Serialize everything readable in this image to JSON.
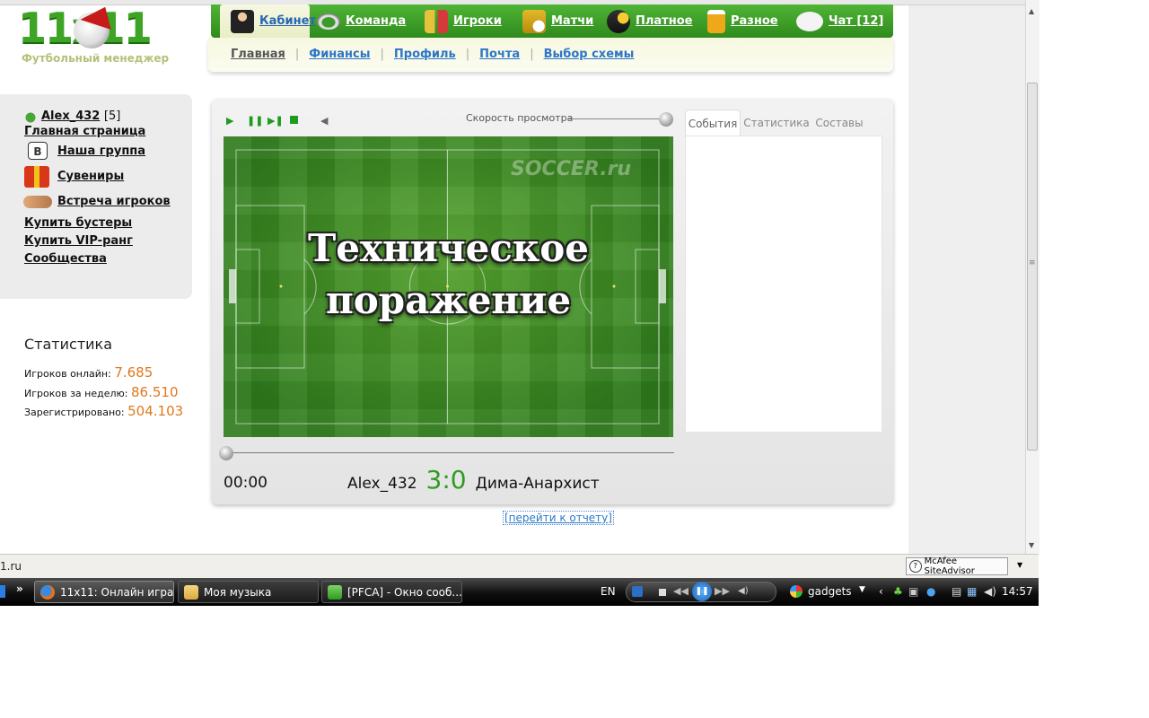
{
  "logo": {
    "number": "11x11",
    "subtitle": "Футбольный менеджер"
  },
  "topnav": [
    {
      "label": "Кабинет",
      "icon": "manager-icon"
    },
    {
      "label": "Команда",
      "icon": "stadium-icon"
    },
    {
      "label": "Игроки",
      "icon": "players-icon"
    },
    {
      "label": "Матчи",
      "icon": "trophy-ball-icon"
    },
    {
      "label": "Платное",
      "icon": "coins-icon"
    },
    {
      "label": "Разное",
      "icon": "beer-icon"
    },
    {
      "label": "Чат [12]",
      "icon": "chat-bubble-icon"
    }
  ],
  "subnav": [
    "Главная",
    "Финансы",
    "Профиль",
    "Почта",
    "Выбор схемы"
  ],
  "sidebar": {
    "user": "Alex_432",
    "user_level": "[5]",
    "main_page": "Главная страница",
    "group": "Наша группа",
    "souvenirs": "Сувениры",
    "meeting": "Встреча игроков",
    "buy_boosters": "Купить бустеры",
    "buy_vip": "Купить VIP-ранг",
    "communities": "Сообщества"
  },
  "stats": {
    "title": "Статистика",
    "online_label": "Игроков онлайн:",
    "online_value": "7.685",
    "week_label": "Игроков за неделю:",
    "week_value": "86.510",
    "registered_label": "Зарегистрировано:",
    "registered_value": "504.103"
  },
  "player": {
    "speed_label": "Скорость просмотра",
    "watermark": "SOCCER.ru",
    "overlay_line1": "Техническое",
    "overlay_line2": "поражение",
    "tabs": [
      "События",
      "Статистика",
      "Составы"
    ],
    "time": "00:00",
    "home": "Alex_432",
    "score": "3:0",
    "away": "Дима-Анархист"
  },
  "report_link": "[перейти к отчету]",
  "statusbar": {
    "url": "1.ru",
    "mcafee": "McAfee SiteAdvisor"
  },
  "taskbar": {
    "buttons": [
      "11x11: Онлайн игра...",
      "Моя музыка",
      "[PFCA] - Окно сооб..."
    ],
    "lang": "EN",
    "gadgets": "gadgets",
    "clock": "14:57"
  }
}
